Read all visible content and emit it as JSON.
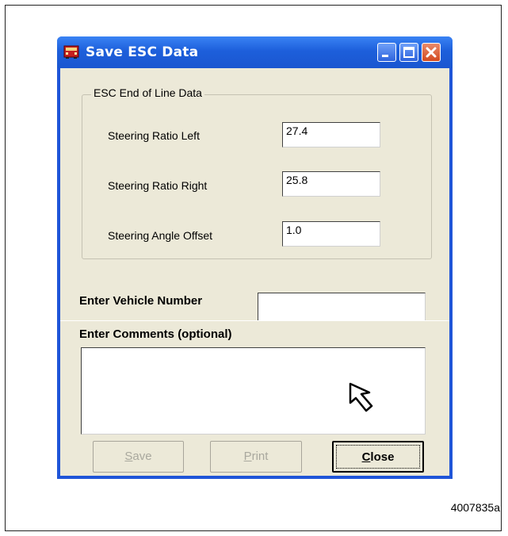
{
  "window": {
    "title": "Save ESC Data",
    "accent_color": "#1f55d8",
    "icons": [
      "app-icon",
      "minimize-icon",
      "maximize-icon",
      "close-icon"
    ]
  },
  "group": {
    "title": "ESC End of Line Data",
    "rows": [
      {
        "label": "Steering Ratio Left",
        "value": "27.4"
      },
      {
        "label": "Steering Ratio Right",
        "value": "25.8"
      },
      {
        "label": "Steering Angle Offset",
        "value": "1.0"
      }
    ]
  },
  "vehicle": {
    "label": "Enter Vehicle Number",
    "value": ""
  },
  "comments": {
    "label": "Enter Comments (optional)",
    "value": ""
  },
  "buttons": {
    "save": {
      "label": "Save",
      "accel": "S"
    },
    "print": {
      "label": "Print",
      "accel": "P"
    },
    "close": {
      "label": "Close",
      "accel": "C"
    }
  },
  "figure_id": "4007835a"
}
